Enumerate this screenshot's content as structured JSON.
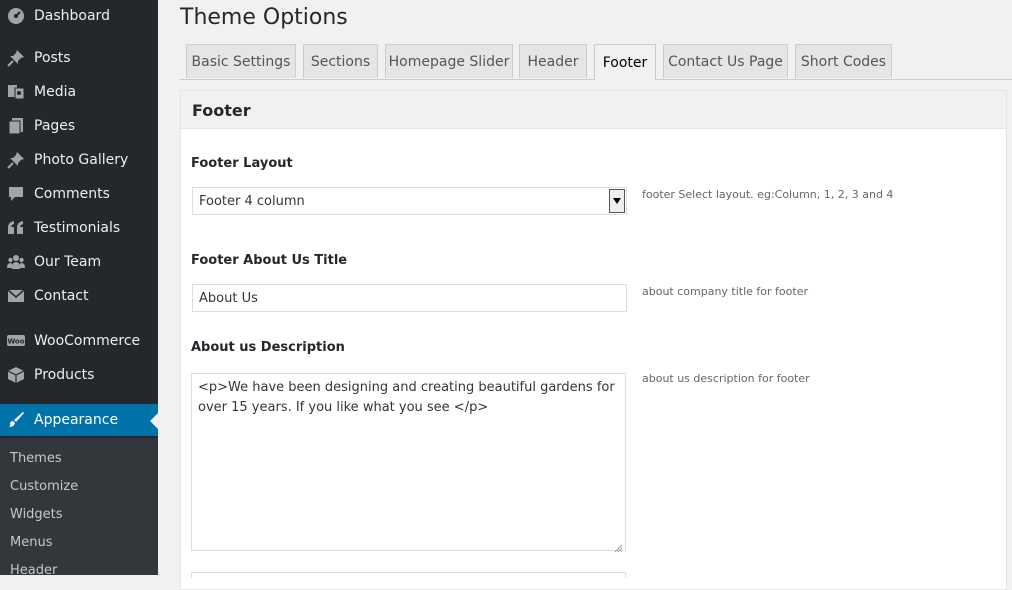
{
  "sidebar": {
    "items": [
      {
        "label": "Dashboard",
        "icon": "dashboard-icon"
      },
      {
        "label": "Posts",
        "icon": "pin-icon"
      },
      {
        "label": "Media",
        "icon": "media-icon"
      },
      {
        "label": "Pages",
        "icon": "pages-icon"
      },
      {
        "label": "Photo Gallery",
        "icon": "pin-icon"
      },
      {
        "label": "Comments",
        "icon": "comment-icon"
      },
      {
        "label": "Testimonials",
        "icon": "quote-icon"
      },
      {
        "label": "Our Team",
        "icon": "team-icon"
      },
      {
        "label": "Contact",
        "icon": "mail-icon"
      },
      {
        "label": "WooCommerce",
        "icon": "woocommerce-icon"
      },
      {
        "label": "Products",
        "icon": "box-icon"
      },
      {
        "label": "Appearance",
        "icon": "brush-icon"
      }
    ],
    "submenu": [
      "Themes",
      "Customize",
      "Widgets",
      "Menus",
      "Header"
    ]
  },
  "page_title": "Theme Options",
  "tabs": [
    "Basic Settings",
    "Sections",
    "Homepage Slider",
    "Header",
    "Footer",
    "Contact Us Page",
    "Short Codes"
  ],
  "active_tab": "Footer",
  "panel": {
    "title": "Footer",
    "fields": {
      "layout": {
        "label": "Footer Layout",
        "value": "Footer 4 column",
        "desc": "footer Select layout. eg:Column, 1, 2, 3 and 4"
      },
      "about_title": {
        "label": "Footer About Us Title",
        "value": "About Us",
        "desc": "about company title for footer"
      },
      "about_desc": {
        "label": "About us Description",
        "value": "<p>We have been designing and creating beautiful gardens for over 15 years. If you like what you see </p>",
        "desc": "about us description for footer"
      }
    }
  },
  "colors": {
    "sidebar_bg": "#23282d",
    "submenu_bg": "#32373c",
    "accent": "#0073aa"
  }
}
